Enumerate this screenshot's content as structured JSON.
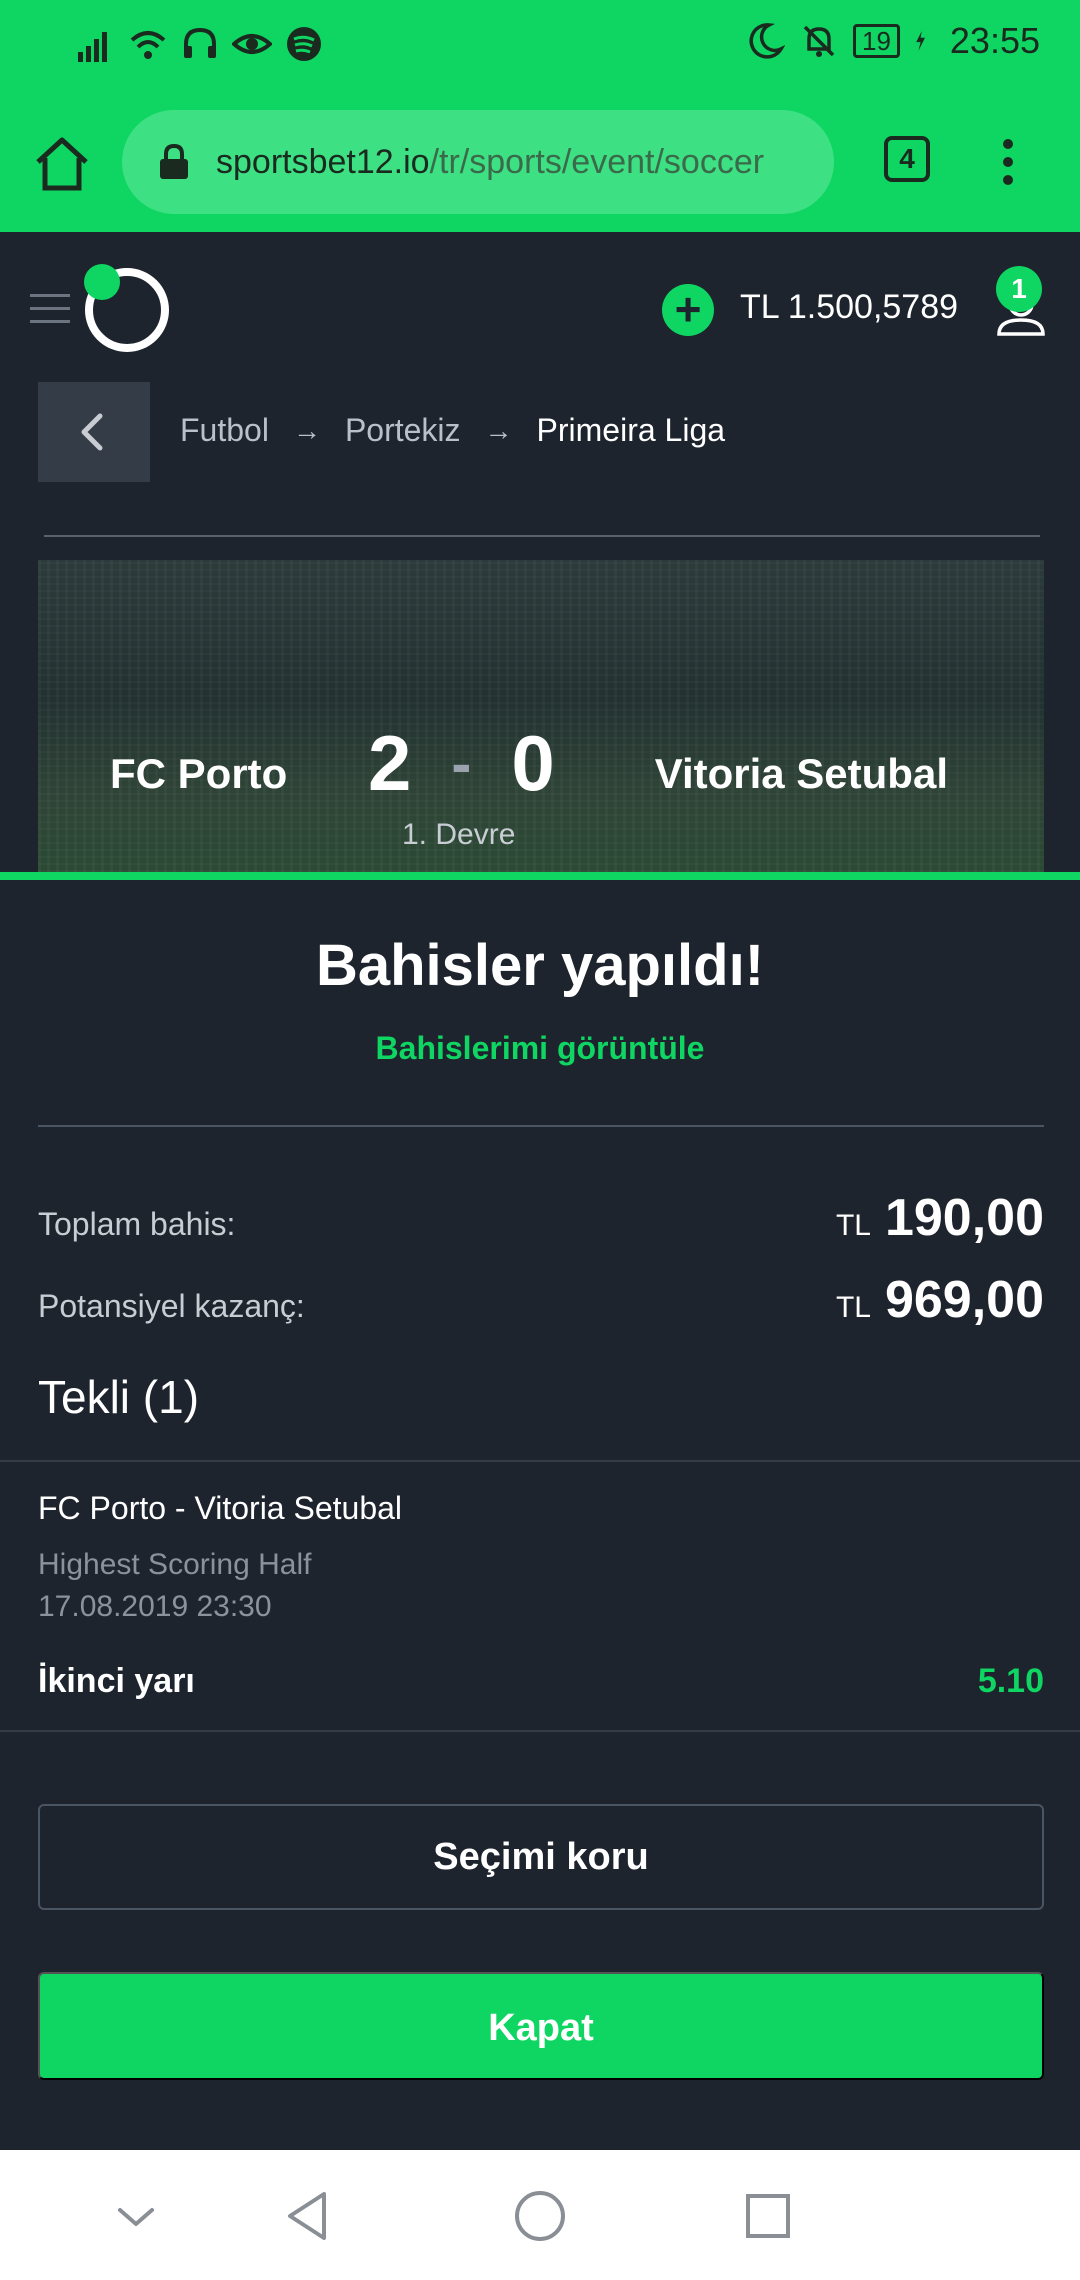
{
  "status_bar": {
    "time": "23:55",
    "battery": "19",
    "icons": [
      "signal-icon",
      "wifi-icon",
      "headset-icon",
      "eye-icon",
      "spotify-icon",
      "moon-icon",
      "bell-off-icon",
      "battery-icon",
      "charging-icon"
    ]
  },
  "browser": {
    "url_host": "sportsbet12.io",
    "url_path": "/tr/sports/event/soccer",
    "tab_count": "4"
  },
  "header": {
    "balance": "TL 1.500,5789",
    "notification_count": "1"
  },
  "breadcrumb": {
    "items": [
      "Futbol",
      "Portekiz",
      "Primeira Liga"
    ],
    "separator": "→"
  },
  "match": {
    "home_team": "FC Porto",
    "away_team": "Vitoria Setubal",
    "home_score": "2",
    "away_score": "0",
    "score_separator": "-",
    "period": "1. Devre"
  },
  "bet_confirmation": {
    "title": "Bahisler yapıldı!",
    "view_bets_link": "Bahislerimi görüntüle",
    "total_stake_label": "Toplam bahis:",
    "total_stake_currency": "TL",
    "total_stake_value": "190,00",
    "potential_win_label": "Potansiyel kazanç:",
    "potential_win_currency": "TL",
    "potential_win_value": "969,00",
    "section_title": "Tekli (1)",
    "bet": {
      "match": "FC Porto - Vitoria Setubal",
      "market": "Highest Scoring Half",
      "date": "17.08.2019 23:30",
      "selection": "İkinci yarı",
      "odds": "5.10"
    },
    "keep_selection_button": "Seçimi koru",
    "close_button": "Kapat"
  },
  "colors": {
    "accent": "#0fd562",
    "background": "#1e242e"
  }
}
